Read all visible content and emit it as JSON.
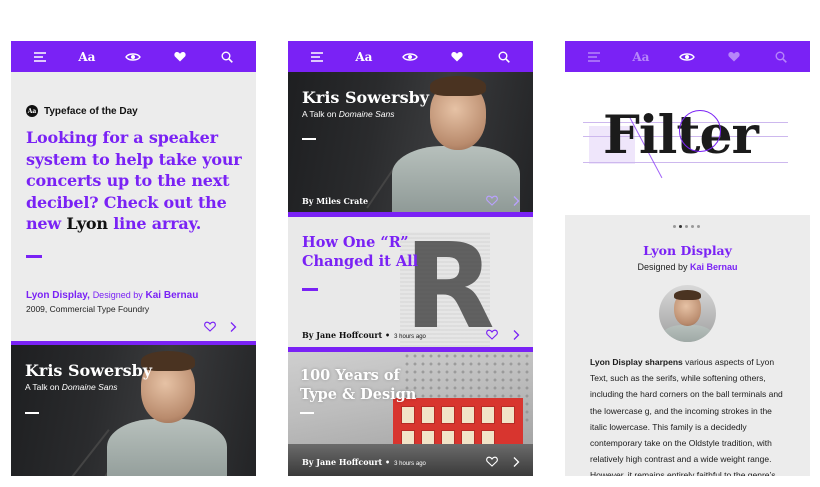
{
  "accent": "#7a22f5",
  "icons": [
    "menu-icon",
    "type-aa-icon",
    "eye-icon",
    "heart-icon",
    "search-icon",
    "chevron-right-icon"
  ],
  "topbar": {
    "type_label": "Aa"
  },
  "phone1": {
    "totd_badge": "Aa",
    "totd_label": "Typeface of the Day",
    "hero_part1": "Looking for a speaker system to help take your concerts up to the next decibel? Check out the new ",
    "hero_font_name": "Lyon",
    "hero_part2": " line array.",
    "font_name": "Lyon Display,",
    "designed_by": "Designed by",
    "designer": "Kai Bernau",
    "meta": "2009, Commercial Type Foundry",
    "card": {
      "title": "Kris Sowersby",
      "sub_prefix": "A Talk on",
      "sub_font": "Domaine Sans"
    }
  },
  "phone2": {
    "talk": {
      "title": "Kris Sowersby",
      "sub_prefix": "A Talk on",
      "sub_font": "Domaine Sans",
      "byline": "By Miles Crate"
    },
    "article": {
      "title_line1": "How One “R”",
      "title_line2": "Changed it All",
      "big_letter": "R",
      "byline": "By Jane Hoffcourt",
      "dot": "•",
      "time": "3 hours ago"
    },
    "exhibit": {
      "title_line1": "100 Years of",
      "title_line2": "Type & Design",
      "byline": "By Jane Hoffcourt",
      "dot": "•",
      "time": "3 hours ago"
    }
  },
  "phone3": {
    "specimen_word": "Filter",
    "specimen_letter": "t",
    "font_title": "Lyon Display",
    "designed_by": "Designed by",
    "designer": "Kai Bernau",
    "body_lead": "Lyon Display sharpens",
    "body_rest": " various aspects of Lyon Text, such as the serifs, while softening others, including the hard corners on the ball terminals and the lowercase g, and the incoming strokes in the italic lowercase. This family is a decidedly contemporary take on the Oldstyle tradition, with relatively high contrast and a wide weight range. However, it remains entirely faithful to the genre’s"
  }
}
